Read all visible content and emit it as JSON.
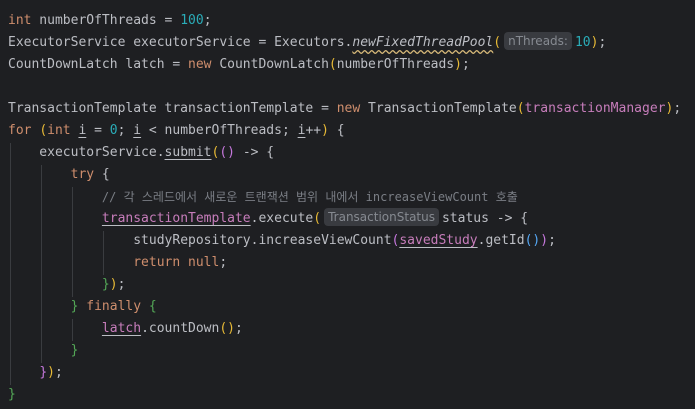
{
  "editor": {
    "theme": {
      "background": "#1e1f22",
      "text": "#bcbec4",
      "keyword": "#cf8e6d",
      "number": "#2aacb8",
      "field": "#c77dbb",
      "comment": "#7a7e85"
    },
    "l1": {
      "kw": "int",
      "rest": " numberOfThreads = ",
      "num": "100",
      "end": ";"
    },
    "l2": {
      "a": "ExecutorService executorService = Executors.",
      "m": "newFixedThreadPool",
      "p": "(",
      "hint": "nThreads:",
      "num": "10",
      "pc": ")",
      "end": ";"
    },
    "l3": {
      "a": "CountDownLatch latch = ",
      "kw": "new",
      "b": " CountDownLatch",
      "p": "(",
      "arg": "numberOfThreads",
      "pc": ")",
      "end": ";"
    },
    "l5": {
      "a": "TransactionTemplate transactionTemplate = ",
      "kw": "new",
      "b": " TransactionTemplate",
      "p": "(",
      "fld": "transactionManager",
      "pc": ")",
      "end": ";"
    },
    "l6": {
      "kw1": "for",
      "sp": " ",
      "p": "(",
      "kw2": "int",
      "s1": " ",
      "i1": "i",
      "s2": " = ",
      "num": "0",
      "s3": "; ",
      "i2": "i",
      "s4": " < numberOfThreads; ",
      "i3": "i",
      "s5": "++",
      "pc": ")",
      "b": " {"
    },
    "l7": {
      "a": "    executorService.",
      "m": "submit",
      "p1": "(",
      "p2": "()",
      "b": " -> {"
    },
    "l8": {
      "ind": "        ",
      "kw": "try",
      "b": " {"
    },
    "l9": {
      "ind": "            ",
      "cmt": "// 각 스레드에서 새로운 트랜잭션 범위 내에서 increaseViewCount 호출"
    },
    "l10": {
      "ind": "            ",
      "fld": "transactionTemplate",
      "a": ".execute",
      "p": "(",
      "hint": "TransactionStatus",
      "b": "status -> {"
    },
    "l11": {
      "ind": "                ",
      "a": "studyRepository.increaseViewCount",
      "p": "(",
      "fld": "savedStudy",
      "b": ".getId",
      "p2": "()",
      "pc": ")",
      "end": ";"
    },
    "l12": {
      "ind": "                ",
      "kw1": "return",
      "s": " ",
      "kw2": "null",
      "end": ";"
    },
    "l13": {
      "ind": "            ",
      "a": "}",
      "pc": ")",
      "end": ";"
    },
    "l14": {
      "ind": "        ",
      "a": "} ",
      "kw": "finally",
      "b": " {"
    },
    "l15": {
      "ind": "            ",
      "fld": "latch",
      "a": ".countDown",
      "p": "()",
      "end": ";"
    },
    "l16": {
      "ind": "        ",
      "a": "}"
    },
    "l17": {
      "ind": "    ",
      "a": "}",
      "pc": ")",
      "end": ";"
    },
    "l18": {
      "a": "}"
    }
  }
}
